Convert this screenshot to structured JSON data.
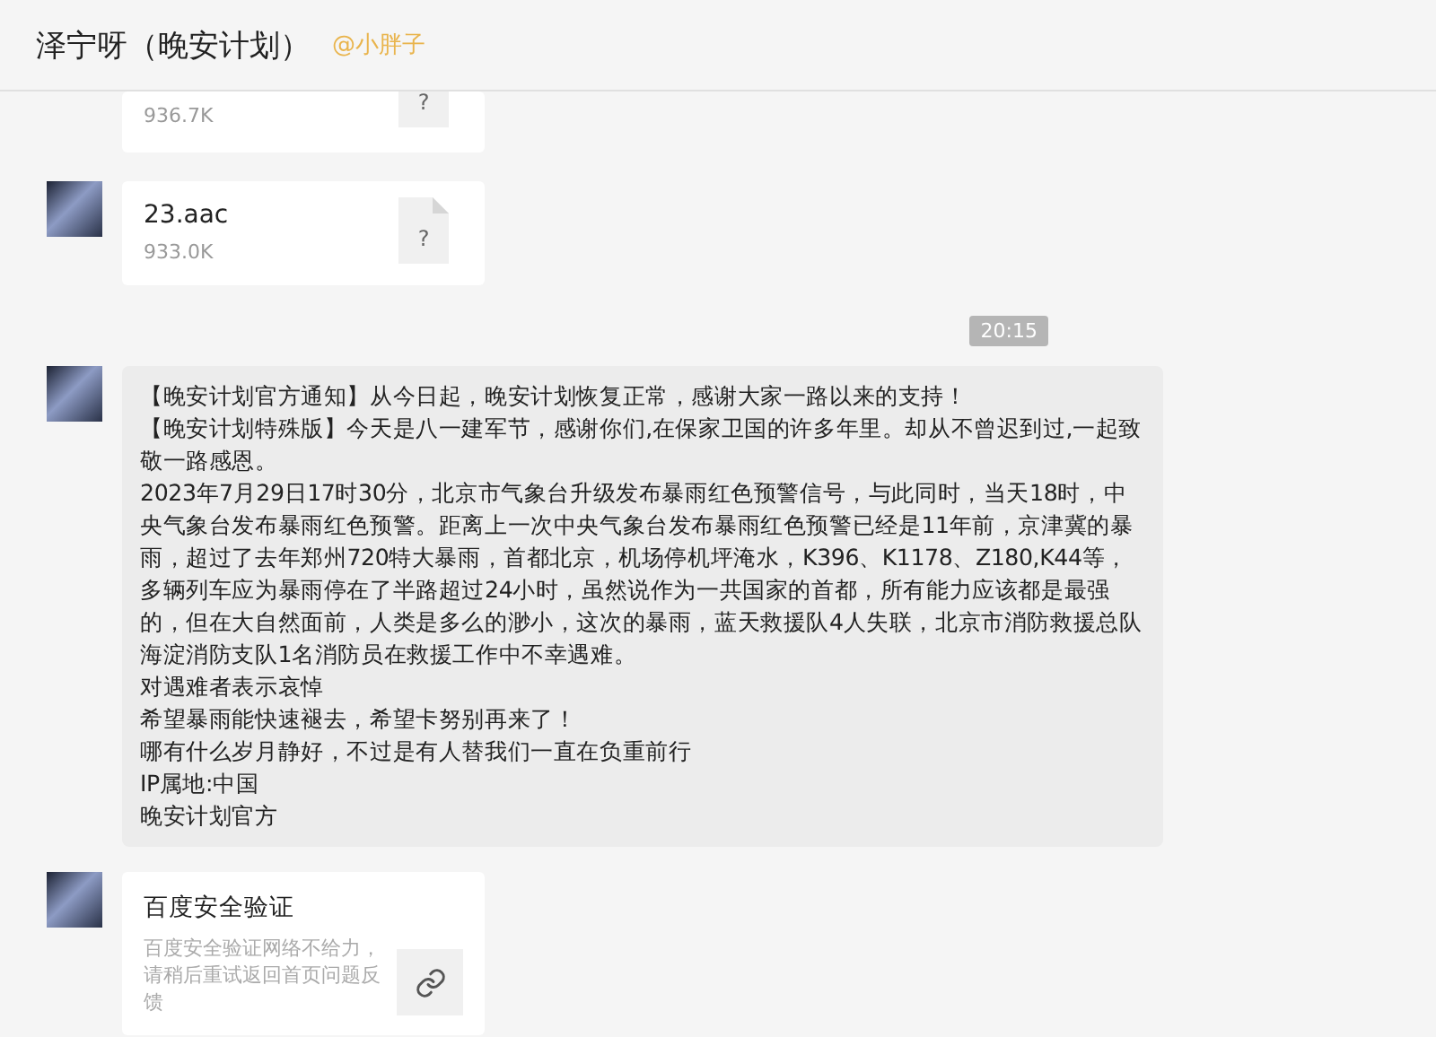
{
  "header": {
    "title": "泽宁呀（晚安计划）",
    "mention": "@小胖子"
  },
  "messages": [
    {
      "kind": "file",
      "cut": true,
      "size": "936.7K",
      "icon_text": "?"
    },
    {
      "kind": "file",
      "cut": false,
      "name": "23.aac",
      "size": "933.0K",
      "icon_text": "?"
    },
    {
      "kind": "time",
      "text": "20:15"
    },
    {
      "kind": "text",
      "paragraphs": [
        "【晚安计划官方通知】从今日起，晚安计划恢复正常，感谢大家一路以来的支持！",
        "【晚安计划特殊版】今天是八一建军节，感谢你们,在保家卫国的许多年里。却从不曾迟到过,一起致敬一路感恩。",
        "2023年7月29日17时30分，北京市气象台升级发布暴雨红色预警信号，与此同时，当天18时，中央气象台发布暴雨红色预警。距离上一次中央气象台发布暴雨红色预警已经是11年前，京津冀的暴雨，超过了去年郑州720特大暴雨，首都北京，机场停机坪淹水，K396、K1178、Z180,K44等，多辆列车应为暴雨停在了半路超过24小时，虽然说作为一共国家的首都，所有能力应该都是最强的，但在大自然面前，人类是多么的渺小，这次的暴雨，蓝天救援队4人失联，北京市消防救援总队海淀消防支队1名消防员在救援工作中不幸遇难。",
        "对遇难者表示哀悼",
        "希望暴雨能快速褪去，希望卡努别再来了！",
        "哪有什么岁月静好，不过是有人替我们一直在负重前行",
        "IP属地:中国",
        "晚安计划官方"
      ]
    },
    {
      "kind": "link",
      "title": "百度安全验证",
      "desc": "百度安全验证网络不给力，请稍后重试返回首页问题反馈"
    }
  ]
}
